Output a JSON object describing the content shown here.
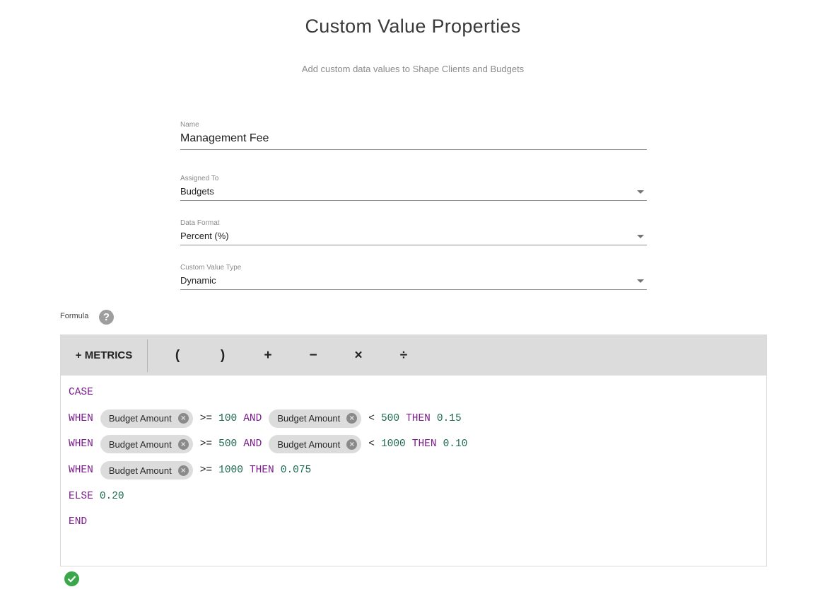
{
  "header": {
    "title": "Custom Value Properties",
    "subtitle": "Add custom data values to Shape Clients and Budgets"
  },
  "form": {
    "name": {
      "label": "Name",
      "value": "Management Fee"
    },
    "assigned_to": {
      "label": "Assigned To",
      "value": "Budgets"
    },
    "data_format": {
      "label": "Data Format",
      "value": "Percent (%)"
    },
    "custom_value_type": {
      "label": "Custom Value Type",
      "value": "Dynamic"
    }
  },
  "formula": {
    "label": "Formula",
    "help_icon": "?",
    "toolbar": {
      "metrics_label": "+ METRICS",
      "operators": [
        "(",
        ")",
        "+",
        "−",
        "×",
        "÷"
      ]
    },
    "chip_label": "Budget Amount",
    "chip_close": "×",
    "lines": [
      {
        "tokens": [
          {
            "t": "kw",
            "v": "CASE"
          }
        ]
      },
      {
        "tokens": [
          {
            "t": "kw",
            "v": "WHEN"
          },
          {
            "t": "chip"
          },
          {
            "t": "op",
            "v": ">="
          },
          {
            "t": "num",
            "v": "100"
          },
          {
            "t": "kw",
            "v": "AND"
          },
          {
            "t": "chip"
          },
          {
            "t": "op",
            "v": "<"
          },
          {
            "t": "num",
            "v": "500"
          },
          {
            "t": "kw",
            "v": "THEN"
          },
          {
            "t": "num",
            "v": "0.15"
          }
        ]
      },
      {
        "tokens": [
          {
            "t": "kw",
            "v": "WHEN"
          },
          {
            "t": "chip"
          },
          {
            "t": "op",
            "v": ">="
          },
          {
            "t": "num",
            "v": "500"
          },
          {
            "t": "kw",
            "v": "AND"
          },
          {
            "t": "chip"
          },
          {
            "t": "op",
            "v": "<"
          },
          {
            "t": "num",
            "v": "1000"
          },
          {
            "t": "kw",
            "v": "THEN"
          },
          {
            "t": "num",
            "v": "0.10"
          }
        ]
      },
      {
        "tokens": [
          {
            "t": "kw",
            "v": "WHEN"
          },
          {
            "t": "chip"
          },
          {
            "t": "op",
            "v": ">="
          },
          {
            "t": "num",
            "v": "1000"
          },
          {
            "t": "kw",
            "v": "THEN"
          },
          {
            "t": "num",
            "v": "0.075"
          }
        ]
      },
      {
        "tokens": [
          {
            "t": "kw",
            "v": "ELSE"
          },
          {
            "t": "num",
            "v": "0.20"
          }
        ]
      },
      {
        "tokens": [
          {
            "t": "kw",
            "v": "END"
          }
        ]
      }
    ],
    "status": "valid"
  },
  "colors": {
    "keyword": "#7b1c8c",
    "number": "#1d6b4f",
    "valid": "#3aa74a",
    "toolbar_bg": "#dcdcdc"
  }
}
